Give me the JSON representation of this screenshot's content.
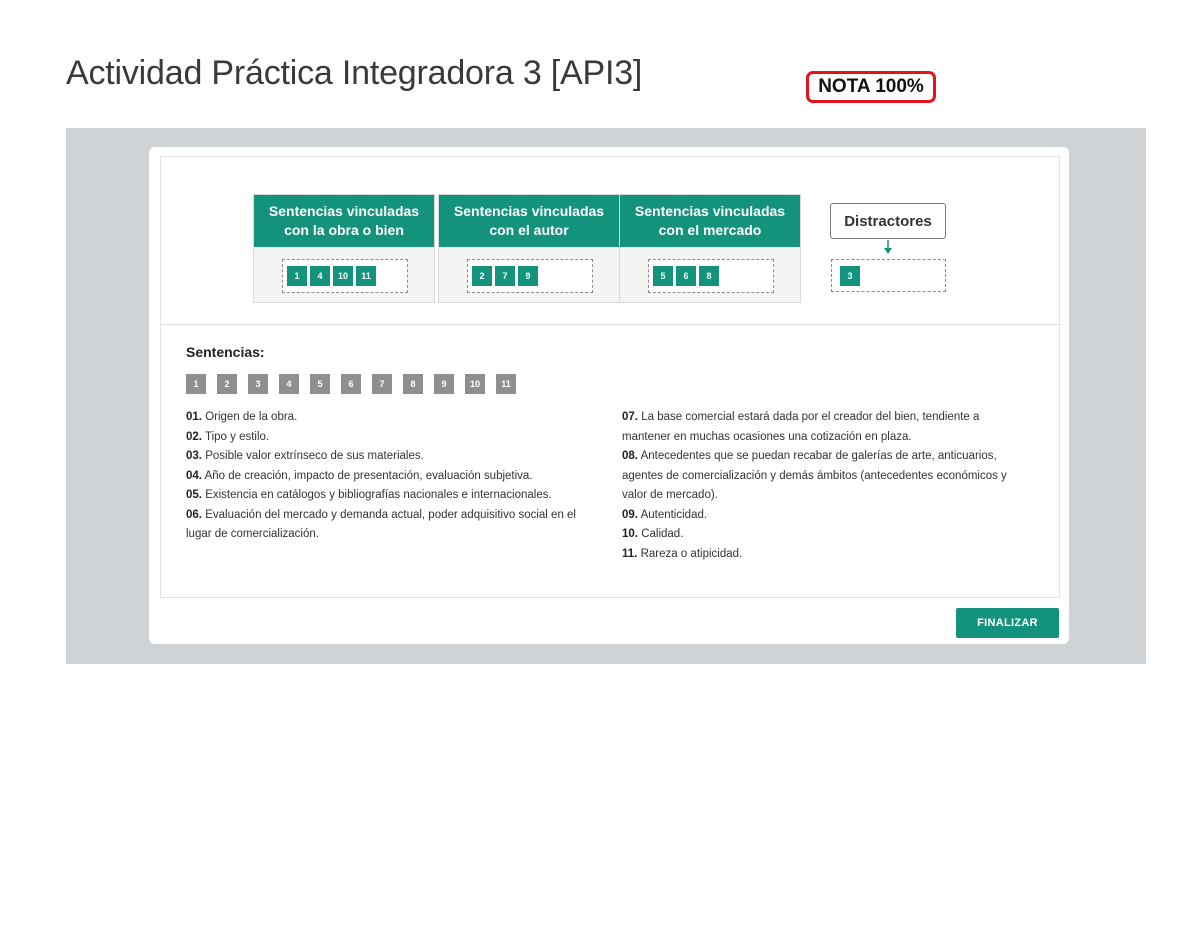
{
  "page": {
    "title": "Actividad Práctica Integradora 3 [API3]",
    "grade": "NOTA 100%"
  },
  "categories": [
    {
      "header": "Sentencias vinculadas\ncon la obra o bien",
      "placed": [
        "1",
        "4",
        "10",
        "11"
      ]
    },
    {
      "header": "Sentencias vinculadas\ncon el autor",
      "placed": [
        "2",
        "7",
        "9"
      ]
    },
    {
      "header": "Sentencias vinculadas\ncon el mercado",
      "placed": [
        "5",
        "6",
        "8"
      ]
    }
  ],
  "distractors": {
    "label": "Distractores",
    "placed": [
      "3"
    ]
  },
  "sentences": {
    "heading": "Sentencias:",
    "bank": [
      "1",
      "2",
      "3",
      "4",
      "5",
      "6",
      "7",
      "8",
      "9",
      "10",
      "11"
    ],
    "items": [
      {
        "num": "01.",
        "text": "Origen de la obra."
      },
      {
        "num": "02.",
        "text": "Tipo y estilo."
      },
      {
        "num": "03.",
        "text": "Posible valor extrínseco de sus materiales."
      },
      {
        "num": "04.",
        "text": "Año de creación, impacto de presentación, evaluación subjetiva."
      },
      {
        "num": "05.",
        "text": "Existencia en catálogos y bibliografías nacionales e internacionales."
      },
      {
        "num": "06.",
        "text": "Evaluación del mercado y demanda actual, poder adquisitivo social en el lugar de comercialización."
      },
      {
        "num": "07.",
        "text": "La base comercial estará dada por el creador del bien, tendiente a mantener en muchas ocasiones una cotización en plaza."
      },
      {
        "num": "08.",
        "text": "Antecedentes que se puedan recabar de galerías de arte, anticuarios, agentes de comercialización y demás ámbitos (antecedentes económicos y valor de mercado)."
      },
      {
        "num": "09.",
        "text": "Autenticidad."
      },
      {
        "num": "10.",
        "text": "Calidad."
      },
      {
        "num": "11.",
        "text": "Rareza o atipicidad."
      }
    ]
  },
  "footer": {
    "finish_label": "FINALIZAR"
  },
  "colors": {
    "accent": "#14937c",
    "bank_chip": "#8f8f8f",
    "grade_border": "#e2141b"
  }
}
